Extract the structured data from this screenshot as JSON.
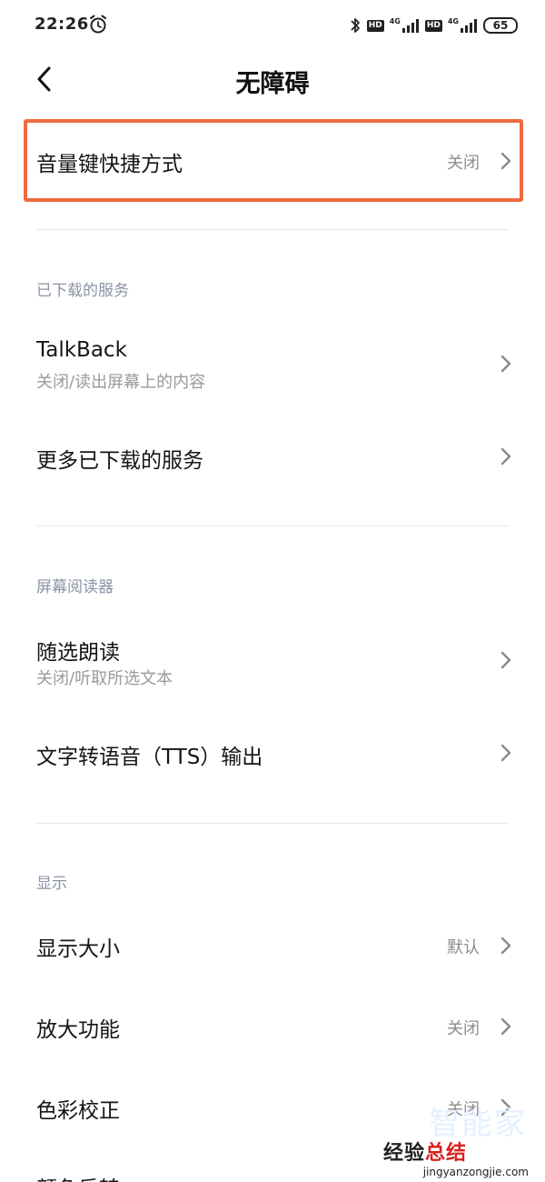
{
  "status_bar": {
    "time": "22:26",
    "hd1": "HD",
    "net1": "4G",
    "hd2": "HD",
    "net2": "4G",
    "battery": "65"
  },
  "header": {
    "title": "无障碍"
  },
  "top_item": {
    "title": "音量键快捷方式",
    "value": "关闭"
  },
  "sections": {
    "downloaded": {
      "label": "已下载的服务",
      "talkback_title": "TalkBack",
      "talkback_sub": "关闭/读出屏幕上的内容",
      "more_title": "更多已下载的服务"
    },
    "screen_reader": {
      "label": "屏幕阅读器",
      "select_title": "随选朗读",
      "select_sub": "关闭/听取所选文本",
      "tts_title": "文字转语音（TTS）输出"
    },
    "display": {
      "label": "显示",
      "size_title": "显示大小",
      "size_value": "默认",
      "magnify_title": "放大功能",
      "magnify_value": "关闭",
      "color_title": "色彩校正",
      "color_value": "关闭",
      "partial_title": "颜色反转"
    }
  },
  "watermark": {
    "ghost": "智能家",
    "main_a": "经验",
    "main_b": "总结",
    "url": "jingyanzongjie.com"
  },
  "colors": {
    "highlight": "#ee6a3f",
    "section_label": "#8b93a6"
  }
}
